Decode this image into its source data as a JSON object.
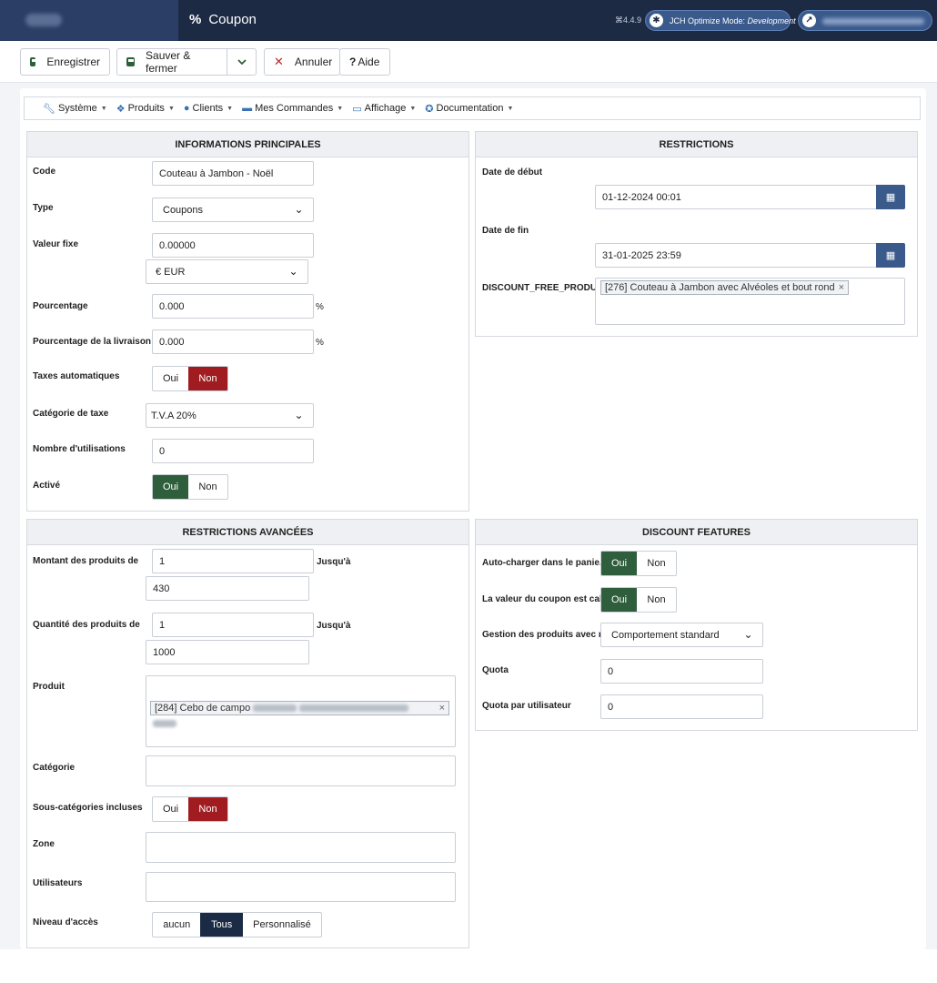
{
  "header": {
    "title": "Coupon",
    "title_icon": "%",
    "version": "⌘4.4.9",
    "jch_label": "JCH Optimize Mode:",
    "jch_mode": "Development"
  },
  "toolbar": {
    "save_label": "Enregistrer",
    "save_close_label": "Sauver & fermer",
    "cancel_label": "Annuler",
    "help_label": "Aide"
  },
  "menu": [
    {
      "label": "Système"
    },
    {
      "label": "Produits"
    },
    {
      "label": "Clients"
    },
    {
      "label": "Mes Commandes"
    },
    {
      "label": "Affichage"
    },
    {
      "label": "Documentation"
    }
  ],
  "main_info": {
    "heading": "INFORMATIONS PRINCIPALES",
    "code_label": "Code",
    "code_value": "Couteau à Jambon - Noël",
    "type_label": "Type",
    "type_value": "Coupons",
    "fixed_label": "Valeur fixe",
    "fixed_value": "0.00000",
    "currency_value": "€ EUR",
    "percent_label": "Pourcentage",
    "percent_value": "0.000",
    "percent_suffix": "%",
    "ship_percent_label": "Pourcentage de la livraison",
    "ship_percent_value": "0.000",
    "ship_percent_suffix": "%",
    "auto_tax_label": "Taxes automatiques",
    "auto_tax_yes": "Oui",
    "auto_tax_no": "Non",
    "tax_cat_label": "Catégorie de taxe",
    "tax_cat_value": "T.V.A 20%",
    "uses_label": "Nombre d'utilisations",
    "uses_value": "0",
    "active_label": "Activé",
    "active_yes": "Oui",
    "active_no": "Non"
  },
  "restrictions": {
    "heading": "RESTRICTIONS",
    "start_label": "Date de début",
    "start_value": "01-12-2024 00:01",
    "end_label": "Date de fin",
    "end_value": "31-01-2025 23:59",
    "free_product_label": "DISCOUNT_FREE_PRODUCT",
    "free_product_tag": "[276] Couteau à Jambon avec Alvéoles et bout rond",
    "tag_remove": "×"
  },
  "advanced": {
    "heading": "RESTRICTIONS AVANCÉES",
    "amount_label": "Montant des produits de",
    "amount_from": "1",
    "amount_to_label": "Jusqu'à",
    "amount_to": "430",
    "qty_label": "Quantité des produits de",
    "qty_from": "1",
    "qty_to_label": "Jusqu'à",
    "qty_to": "1000",
    "product_label": "Produit",
    "product_tag": "[284] Cebo de campo",
    "tag_remove": "×",
    "category_label": "Catégorie",
    "subcat_label": "Sous-catégories incluses",
    "subcat_yes": "Oui",
    "subcat_no": "Non",
    "zone_label": "Zone",
    "users_label": "Utilisateurs",
    "access_label": "Niveau d'accès",
    "access_none": "aucun",
    "access_all": "Tous",
    "access_custom": "Personnalisé"
  },
  "features": {
    "heading": "DISCOUNT FEATURES",
    "autocart_label": "Auto-charger dans le panie...",
    "autocart_yes": "Oui",
    "autocart_no": "Non",
    "calc_label": "La valeur du coupon est cal...",
    "calc_yes": "Oui",
    "calc_no": "Non",
    "mgmt_label": "Gestion des produits avec r...",
    "mgmt_value": "Comportement standard",
    "quota_label": "Quota",
    "quota_value": "0",
    "quota_user_label": "Quota par utilisateur",
    "quota_user_value": "0"
  },
  "colors": {
    "header_bg": "#1d2a44",
    "danger": "#a11c20",
    "success": "#2f5e3c",
    "primary": "#3a5a8c"
  }
}
